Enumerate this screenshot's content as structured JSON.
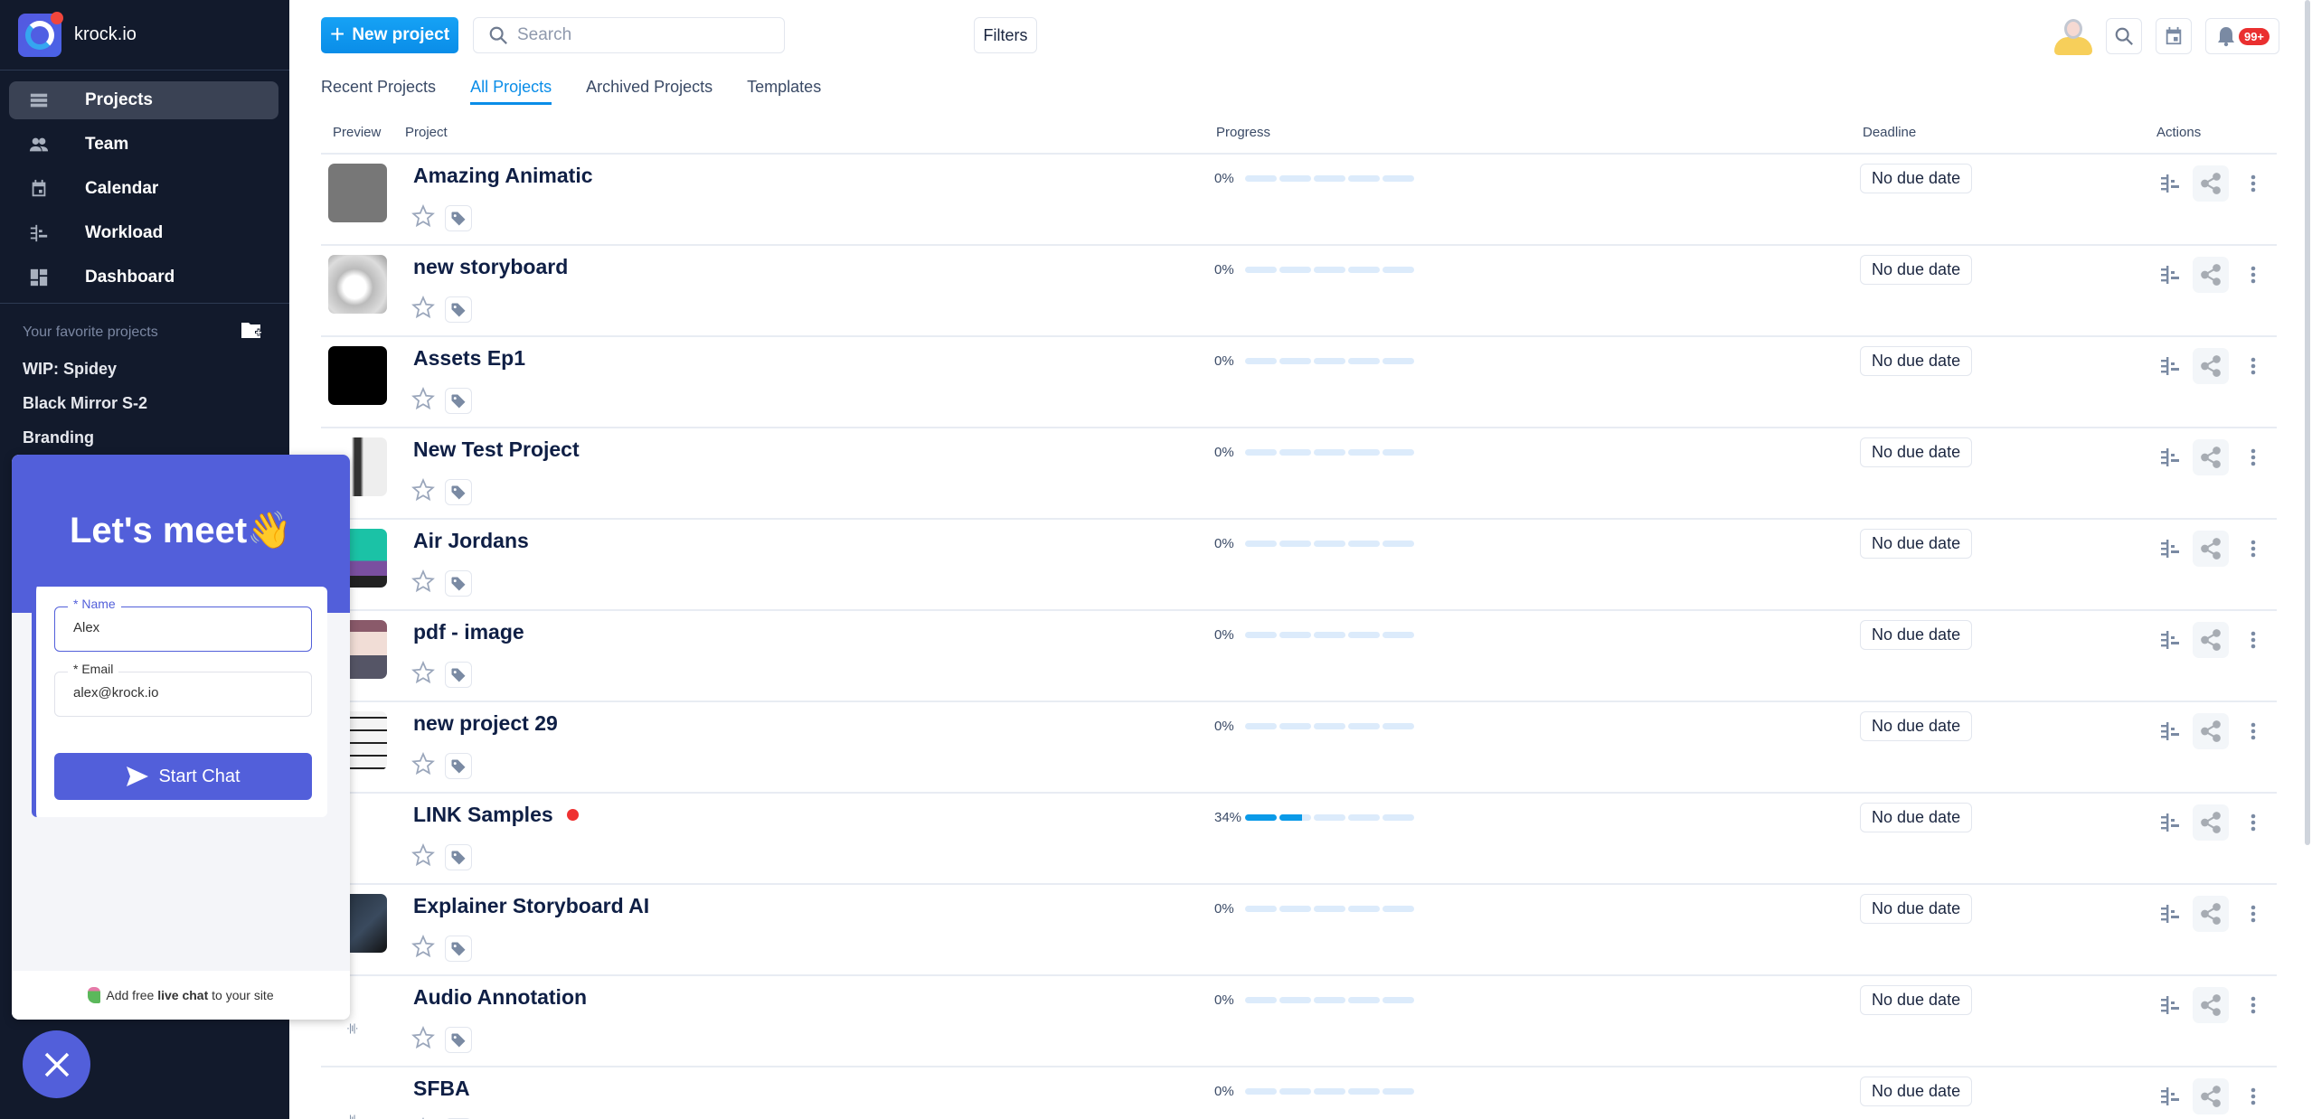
{
  "app": {
    "name": "krock.io"
  },
  "sidebar": {
    "items": [
      {
        "label": "Projects",
        "icon": "list-icon",
        "active": true
      },
      {
        "label": "Team",
        "icon": "team-icon",
        "active": false
      },
      {
        "label": "Calendar",
        "icon": "calendar-icon",
        "active": false
      },
      {
        "label": "Workload",
        "icon": "workload-icon",
        "active": false
      },
      {
        "label": "Dashboard",
        "icon": "dashboard-icon",
        "active": false
      }
    ],
    "favorites_title": "Your favorite projects",
    "favorites": [
      "WIP: Spidey",
      "Black Mirror S-2",
      "Branding"
    ]
  },
  "toolbar": {
    "new_project_label": "New project",
    "search_placeholder": "Search",
    "filters_label": "Filters",
    "notification_count": "99+"
  },
  "tabs": [
    {
      "label": "Recent Projects",
      "active": false
    },
    {
      "label": "All Projects",
      "active": true
    },
    {
      "label": "Archived Projects",
      "active": false
    },
    {
      "label": "Templates",
      "active": false
    }
  ],
  "table": {
    "columns": {
      "preview": "Preview",
      "project": "Project",
      "progress": "Progress",
      "deadline": "Deadline",
      "actions": "Actions"
    },
    "rows": [
      {
        "name": "Amazing Animatic",
        "progress": 0,
        "progress_label": "0%",
        "deadline": "No due date",
        "thumb": "gray",
        "alert": false
      },
      {
        "name": "new storyboard",
        "progress": 0,
        "progress_label": "0%",
        "deadline": "No due date",
        "thumb": "sketch",
        "alert": false
      },
      {
        "name": "Assets Ep1",
        "progress": 0,
        "progress_label": "0%",
        "deadline": "No due date",
        "thumb": "black",
        "alert": false
      },
      {
        "name": "New Test Project",
        "progress": 0,
        "progress_label": "0%",
        "deadline": "No due date",
        "thumb": "bw-photo",
        "alert": false
      },
      {
        "name": "Air Jordans",
        "progress": 0,
        "progress_label": "0%",
        "deadline": "No due date",
        "thumb": "teal-cartoon",
        "alert": false
      },
      {
        "name": "pdf - image",
        "progress": 0,
        "progress_label": "0%",
        "deadline": "No due date",
        "thumb": "illustration",
        "alert": false
      },
      {
        "name": "new project 29",
        "progress": 0,
        "progress_label": "0%",
        "deadline": "No due date",
        "thumb": "text-scribble",
        "alert": false
      },
      {
        "name": "LINK Samples",
        "progress": 34,
        "progress_label": "34%",
        "deadline": "No due date",
        "thumb": "none",
        "alert": true
      },
      {
        "name": "Explainer Storyboard AI",
        "progress": 0,
        "progress_label": "0%",
        "deadline": "No due date",
        "thumb": "dark-scene",
        "alert": false
      },
      {
        "name": "Audio Annotation",
        "progress": 0,
        "progress_label": "0%",
        "deadline": "No due date",
        "thumb": "audio",
        "alert": false
      },
      {
        "name": "SFBA",
        "progress": 0,
        "progress_label": "0%",
        "deadline": "No due date",
        "thumb": "audio",
        "alert": false
      }
    ]
  },
  "chat_widget": {
    "title": "Let's meet",
    "title_emoji": "👋",
    "name_label": "* Name",
    "name_value": "Alex",
    "email_label": "* Email",
    "email_value": "alex@krock.io",
    "start_label": "Start Chat",
    "footer_prefix": "Add free ",
    "footer_bold": "live chat",
    "footer_suffix": " to your site"
  },
  "colors": {
    "accent": "#0a8de8",
    "sidebar_bg": "#121a2c",
    "chat_accent": "#525fda",
    "alert": "#ef3131"
  }
}
